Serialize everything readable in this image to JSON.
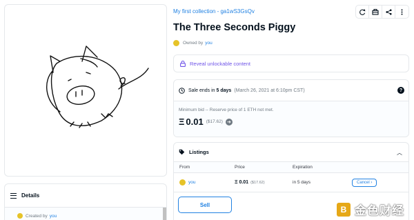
{
  "collection": {
    "link": "My first collection - ga1wS3GsQv"
  },
  "toolbar": {
    "icons": [
      "refresh-icon",
      "transfer-icon",
      "share-icon",
      "more-icon"
    ]
  },
  "item": {
    "title": "The Three Seconds Piggy",
    "owned_prefix": "Owned by",
    "owner": "you"
  },
  "reveal": {
    "label": "Reveal unlockable content"
  },
  "sale": {
    "prefix": "Sale ends in",
    "ends_in": "5 days",
    "date": "(March 26, 2021 at 6:10pm CST)",
    "help": "?",
    "min_bid": "Minimum bid -- Reserve price of 1 ETH not met.",
    "eth_symbol": "Ξ",
    "price": "0.01",
    "usd": "($17.62)"
  },
  "listings": {
    "title": "Listings",
    "columns": [
      "From",
      "Price",
      "Expiration"
    ],
    "rows": [
      {
        "from": "you",
        "price": "Ξ 0.01",
        "usd": "($17.62)",
        "expiration": "in 5 days",
        "action": "Cancel"
      }
    ],
    "sell_label": "Sell"
  },
  "details": {
    "title": "Details",
    "created_prefix": "Created by",
    "creator": "you"
  },
  "watermark": {
    "text": "金色财经"
  },
  "colors": {
    "accent": "#2081e2",
    "purple": "#6f54e8",
    "avatar": "#e6c329"
  }
}
